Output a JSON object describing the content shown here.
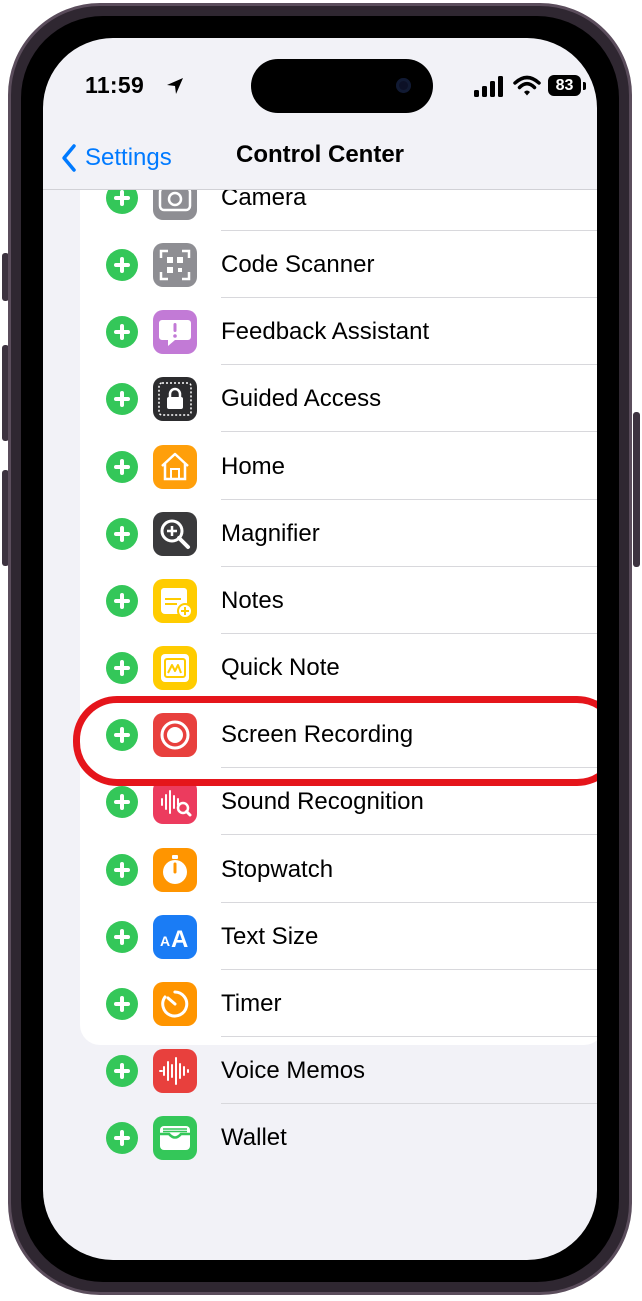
{
  "status_bar": {
    "time": "11:59",
    "battery": "83",
    "icons": [
      "location-arrow-icon",
      "cellular-signal-icon",
      "wifi-icon",
      "battery-icon"
    ]
  },
  "nav": {
    "back_label": "Settings",
    "title": "Control Center"
  },
  "colors": {
    "accent": "#007aff",
    "add_button": "#34c759",
    "highlight": "#e5151b",
    "background": "#f2f2f7"
  },
  "items": [
    {
      "label": "Camera",
      "icon": "camera-icon",
      "icon_color": "#8e8e93"
    },
    {
      "label": "Code Scanner",
      "icon": "qr-code-icon",
      "icon_color": "#8e8e93"
    },
    {
      "label": "Feedback Assistant",
      "icon": "feedback-icon",
      "icon_color": "#c27ad6"
    },
    {
      "label": "Guided Access",
      "icon": "lock-icon",
      "icon_color": "#2c2c2e"
    },
    {
      "label": "Home",
      "icon": "home-icon",
      "icon_color": "#ff9f0a"
    },
    {
      "label": "Magnifier",
      "icon": "magnifier-icon",
      "icon_color": "#3a3a3c"
    },
    {
      "label": "Notes",
      "icon": "notes-icon",
      "icon_color": "#ffcc00"
    },
    {
      "label": "Quick Note",
      "icon": "quick-note-icon",
      "icon_color": "#ffcc00"
    },
    {
      "label": "Screen Recording",
      "icon": "record-icon",
      "icon_color": "#e8403d",
      "highlighted": true
    },
    {
      "label": "Sound Recognition",
      "icon": "sound-recognition-icon",
      "icon_color": "#ec3b5e"
    },
    {
      "label": "Stopwatch",
      "icon": "stopwatch-icon",
      "icon_color": "#ff9500"
    },
    {
      "label": "Text Size",
      "icon": "text-size-icon",
      "icon_color": "#1a7cf5"
    },
    {
      "label": "Timer",
      "icon": "timer-icon",
      "icon_color": "#ff9500"
    },
    {
      "label": "Voice Memos",
      "icon": "voice-memos-icon",
      "icon_color": "#e8403d"
    },
    {
      "label": "Wallet",
      "icon": "wallet-icon",
      "icon_color": "#34c759"
    }
  ]
}
